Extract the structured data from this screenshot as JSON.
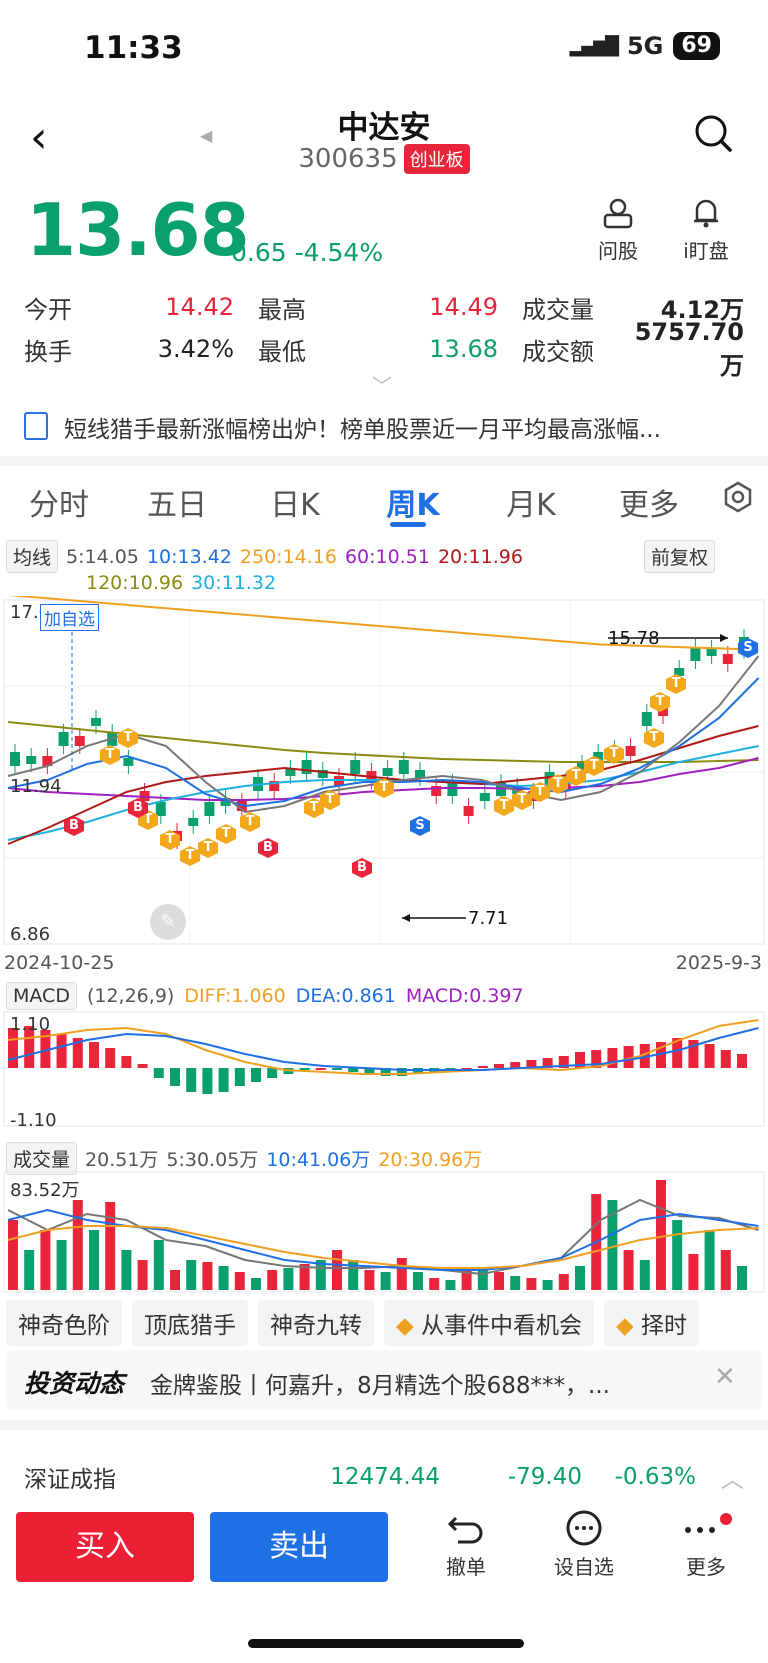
{
  "status": {
    "time": "11:33",
    "network": "5G",
    "battery": "69"
  },
  "header": {
    "title": "中达安",
    "code": "300635",
    "board": "创业板"
  },
  "quote": {
    "price": "13.68",
    "change": "-0.65",
    "change_pct": "-4.54%"
  },
  "tools": {
    "ask": "问股",
    "watch": "i盯盘"
  },
  "stats": [
    {
      "l1": "今开",
      "v1": "14.42",
      "l2": "最高",
      "v2": "14.49",
      "l3": "成交量",
      "v3": "4.12万"
    },
    {
      "l1": "换手",
      "v1": "3.42%",
      "l2": "最低",
      "v2": "13.68",
      "l3": "成交额",
      "v3": "5757.70万"
    }
  ],
  "news": {
    "text": "短线猎手最新涨幅榜出炉！榜单股票近一月平均最高涨幅..."
  },
  "tabs": [
    "分时",
    "五日",
    "日K",
    "周K",
    "月K",
    "更多"
  ],
  "chart": {
    "ma_label": "均线",
    "ma5": "5:14.05",
    "ma10": "10:13.42",
    "ma250": "250:14.16",
    "ma60": "60:10.51",
    "ma20": "20:11.96",
    "ma120": "120:10.96",
    "ma30": "30:11.32",
    "adjust": "前复权",
    "top_price": "17.01",
    "mid_price": "11.94",
    "bottom_price": "6.86",
    "add_watch": "加自选",
    "high_mark": "15.78",
    "low_mark": "7.71",
    "date_start": "2024-10-25",
    "date_end": "2025-9-3",
    "macd_label": "MACD",
    "macd_params": "(12,26,9)",
    "diff": "DIFF:1.060",
    "dea": "DEA:0.861",
    "macd": "MACD:0.397",
    "macd_top": "1.10",
    "macd_bottom": "-1.10",
    "vol_label": "成交量",
    "vol": "20.51万",
    "vol5": "5:30.05万",
    "vol10": "10:41.06万",
    "vol20": "20:30.96万",
    "vol_top": "83.52万",
    "marker_b": "B",
    "marker_t": "T",
    "marker_s": "S"
  },
  "pills": [
    "神奇色阶",
    "顶底猎手",
    "神奇九转",
    "从事件中看机会",
    "择时"
  ],
  "invest": {
    "brand": "投资动态",
    "text": "金牌鉴股丨何嘉升，8月精选个股688***，..."
  },
  "index": {
    "name": "深证成指",
    "value": "12474.44",
    "change": "-79.40",
    "pct": "-0.63%"
  },
  "bottom": {
    "buy": "买入",
    "sell": "卖出",
    "undo": "撤单",
    "watch": "设自选",
    "more": "更多"
  },
  "colors": {
    "up": "#e8253a",
    "down": "#0aa06e",
    "accent": "#1f6fe5"
  }
}
